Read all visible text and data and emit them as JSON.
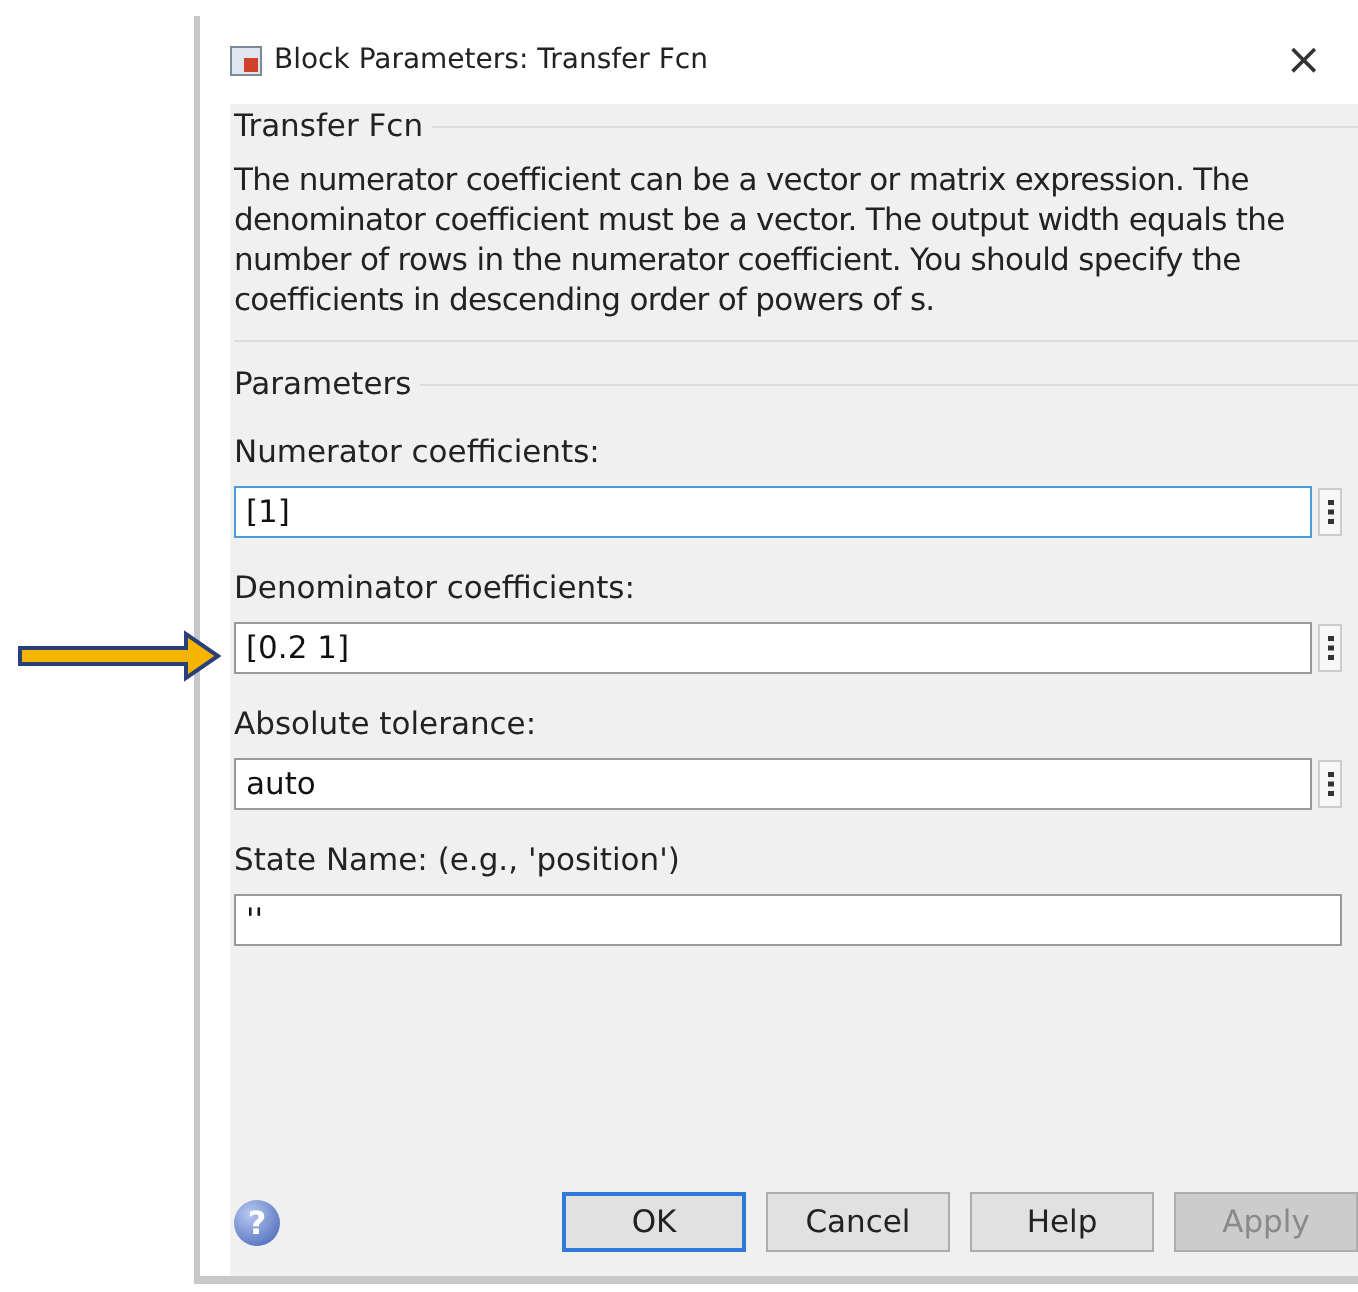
{
  "window": {
    "title": "Block Parameters: Transfer Fcn",
    "close": "×"
  },
  "block": {
    "name": "Transfer Fcn",
    "description": "The numerator coefficient can be a vector or matrix expression. The denominator coefficient must be a vector. The output width equals the number of rows in the numerator coefficient. You should specify the coefficients in descending order of powers of s."
  },
  "parameters": {
    "title": "Parameters",
    "fields": [
      {
        "label": "Numerator coefficients:",
        "value": "[1]",
        "focused": true,
        "has_menu": true
      },
      {
        "label": "Denominator coefficients:",
        "value": "[0.2 1]",
        "focused": false,
        "has_menu": true
      },
      {
        "label": "Absolute tolerance:",
        "value": "auto",
        "focused": false,
        "has_menu": true
      },
      {
        "label": "State Name: (e.g., 'position')",
        "value": "''",
        "focused": false,
        "has_menu": false
      }
    ]
  },
  "help_icon": "?",
  "buttons": [
    {
      "label": "OK",
      "default": true,
      "disabled": false
    },
    {
      "label": "Cancel",
      "default": false,
      "disabled": false
    },
    {
      "label": "Help",
      "default": false,
      "disabled": false
    },
    {
      "label": "Apply",
      "default": false,
      "disabled": true
    }
  ],
  "annotation": {
    "kind": "arrow"
  }
}
